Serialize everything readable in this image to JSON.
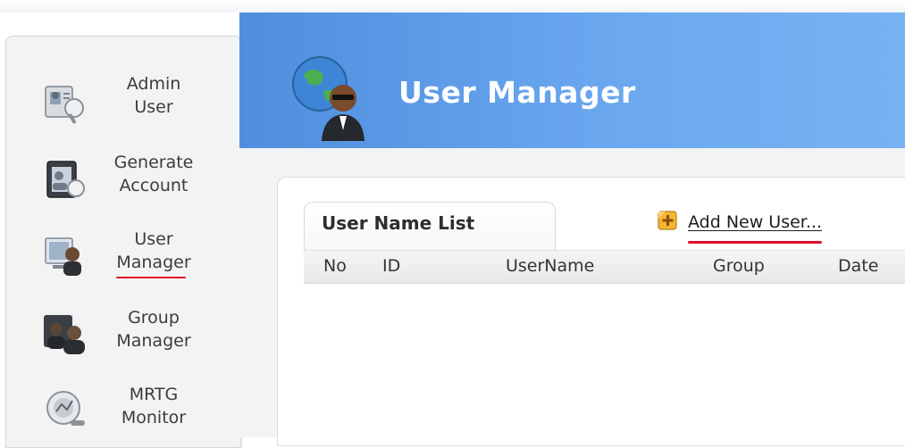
{
  "sidebar": {
    "items": [
      {
        "label": "Admin\nUser",
        "icon": "admin-user-icon"
      },
      {
        "label": "Generate\nAccount",
        "icon": "generate-account-icon"
      },
      {
        "label": "User\nManager",
        "icon": "user-manager-icon",
        "active": true
      },
      {
        "label": "Group\nManager",
        "icon": "group-manager-icon"
      },
      {
        "label": "MRTG\nMonitor",
        "icon": "mrtg-monitor-icon"
      }
    ]
  },
  "header": {
    "title": "User Manager",
    "icon": "globe-user-icon"
  },
  "panel": {
    "tab_title": "User Name List",
    "add_user_label": "Add New User...",
    "add_user_icon": "add-plus-icon",
    "columns": [
      "No",
      "ID",
      "UserName",
      "Group",
      "Date"
    ]
  },
  "colors": {
    "header_blue": "#5c9ae6",
    "highlight_red": "#e0102c",
    "add_icon_yellow": "#f2b632"
  }
}
